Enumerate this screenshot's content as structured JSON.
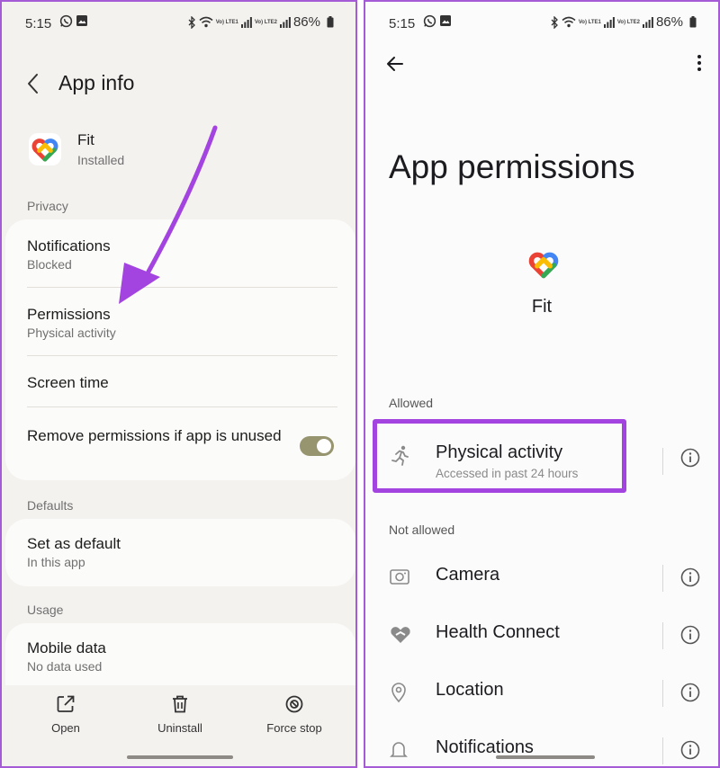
{
  "left": {
    "status": {
      "time": "5:15",
      "battery": "86%",
      "net1": "Vo) LTE1",
      "net2": "Vo) LTE2"
    },
    "header": {
      "title": "App info"
    },
    "app": {
      "name": "Fit",
      "status": "Installed"
    },
    "sections": {
      "privacy": "Privacy",
      "defaults": "Defaults",
      "usage": "Usage"
    },
    "privacy_items": [
      {
        "title": "Notifications",
        "sub": "Blocked"
      },
      {
        "title": "Permissions",
        "sub": "Physical activity"
      },
      {
        "title": "Screen time"
      },
      {
        "title": "Remove permissions if app is unused",
        "toggle_on": true
      }
    ],
    "defaults_items": [
      {
        "title": "Set as default",
        "sub": "In this app"
      }
    ],
    "usage_items": [
      {
        "title": "Mobile data",
        "sub": "No data used"
      }
    ],
    "bottom_bar": [
      {
        "label": "Open",
        "icon": "open-external-icon"
      },
      {
        "label": "Uninstall",
        "icon": "trash-icon"
      },
      {
        "label": "Force stop",
        "icon": "block-icon"
      }
    ],
    "annotation_color": "#a444e0"
  },
  "right": {
    "status": {
      "time": "5:15",
      "battery": "86%",
      "net1": "Vo) LTE1",
      "net2": "Vo) LTE2"
    },
    "header": {
      "title": "App permissions"
    },
    "app": {
      "name": "Fit"
    },
    "sections": {
      "allowed": "Allowed",
      "not_allowed": "Not allowed"
    },
    "allowed": [
      {
        "label": "Physical activity",
        "sub": "Accessed in past 24 hours",
        "icon": "running-person-icon"
      }
    ],
    "not_allowed": [
      {
        "label": "Camera",
        "icon": "camera-icon"
      },
      {
        "label": "Health Connect",
        "icon": "health-connect-icon"
      },
      {
        "label": "Location",
        "icon": "location-pin-icon"
      },
      {
        "label": "Notifications",
        "icon": "bell-icon"
      }
    ],
    "highlight_color": "#a444e0"
  }
}
